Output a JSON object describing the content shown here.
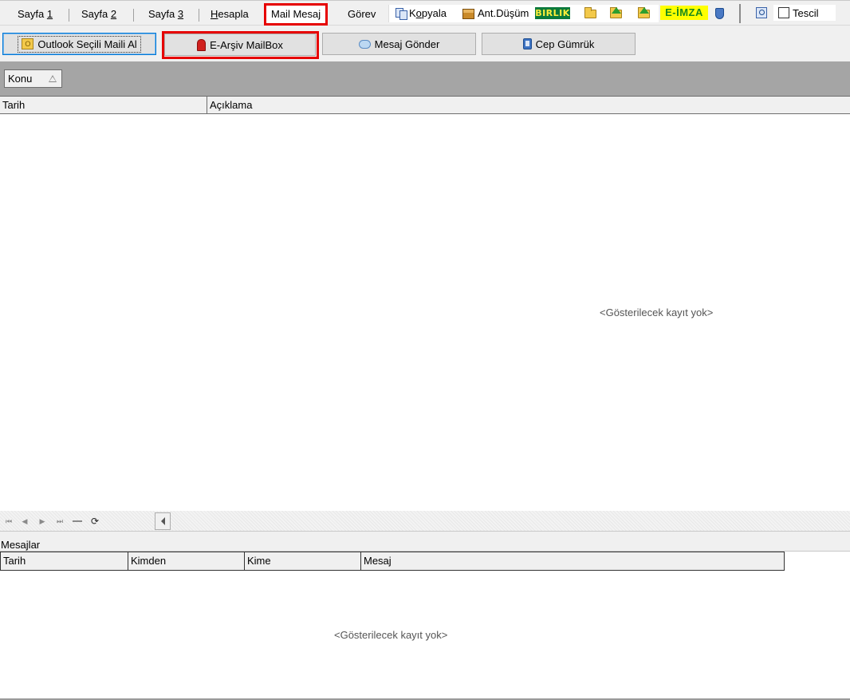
{
  "tabs": [
    {
      "label": "Sayfa 1",
      "pre": "Sayfa ",
      "ul": "1"
    },
    {
      "label": "Sayfa 2",
      "pre": "Sayfa ",
      "ul": "2"
    },
    {
      "label": "Sayfa 3",
      "pre": "Sayfa ",
      "ul": "3"
    },
    {
      "label": "Hesapla",
      "pre": "",
      "ul": "H",
      "post": "esapla"
    },
    {
      "label": "Mail Mesaj"
    },
    {
      "label": "Görev"
    }
  ],
  "toolbar": {
    "kopyala_pre": "K",
    "kopyala_ul": "o",
    "kopyala_post": "pyala",
    "ant_dusum": "Ant.Düşüm",
    "birlik": "BIRLIK",
    "eimza": "E-İMZA",
    "tescil": "Tescil"
  },
  "buttons": {
    "outlook": "Outlook Seçili Maili Al",
    "earsiv": "E-Arşiv MailBox",
    "mesaj_gonder": "Mesaj Gönder",
    "cep_gumruk": "Cep Gümrük"
  },
  "group_panel": {
    "chip": "Konu"
  },
  "grid1": {
    "columns": [
      "Tarih",
      "Açıklama"
    ],
    "empty_text": "<Gösterilecek kayıt yok>"
  },
  "messages": {
    "title": "Mesajlar",
    "columns": [
      "Tarih",
      "Kimden",
      "Kime",
      "Mesaj"
    ],
    "empty_text": "<Gösterilecek kayıt yok>"
  },
  "colors": {
    "highlight": "#e60000",
    "birlik_bg": "#0b7a3b",
    "eimza_bg": "#ffff00",
    "group_panel_bg": "#a5a5a5"
  },
  "icons": [
    "copy-icon",
    "box-icon",
    "folder-open-icon",
    "folder-up-icon",
    "folder-go-icon",
    "shield-icon",
    "magnifier-icon",
    "outlook-icon",
    "mailbox-icon",
    "speech-bubble-icon",
    "phone-icon"
  ]
}
